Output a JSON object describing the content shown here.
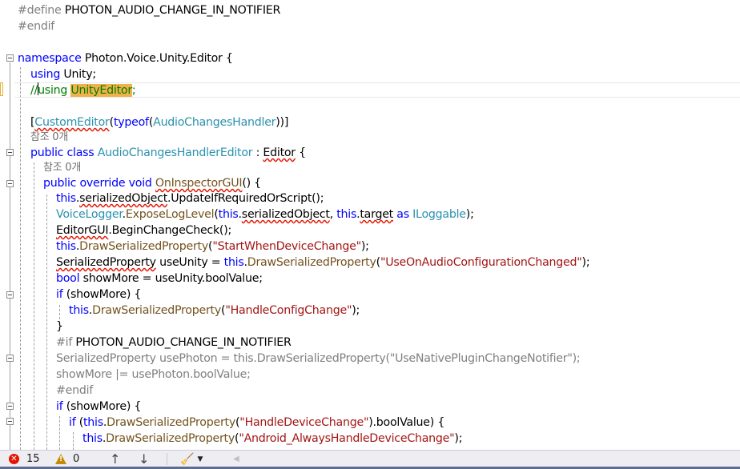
{
  "editor": {
    "lines": {
      "l1": {
        "a": "#define ",
        "b": "PHOTON_AUDIO_CHANGE_IN_NOTIFIER"
      },
      "l2": {
        "a": "#endif"
      },
      "l4": {
        "a": "namespace",
        "b": " Photon.Voice.Unity.Editor {"
      },
      "l5": {
        "a": "using",
        "b": " Unity;"
      },
      "l6": {
        "a": "//",
        "b": "using ",
        "c": "UnityEditor",
        "d": ";"
      },
      "l8": {
        "a": "[",
        "b": "CustomEditor",
        "c": "(",
        "d": "typeof",
        "e": "(",
        "f": "AudioChangesHandler",
        "g": "))]"
      },
      "l9": {
        "a": "참조 0개"
      },
      "l10": {
        "a": "public",
        "b": " ",
        "c": "class",
        "d": " ",
        "e": "AudioChangesHandlerEditor",
        "f": " : ",
        "g": "Editor",
        "h": " {"
      },
      "l11": {
        "a": "참조 0개"
      },
      "l12": {
        "a": "public",
        "b": " ",
        "c": "override",
        "d": " ",
        "e": "void",
        "f": " ",
        "g": "OnInspectorGUI",
        "h": "() {"
      },
      "l13": {
        "a": "this",
        "b": ".",
        "c": "serializedObject",
        "d": ".UpdateIfRequiredOrScript();"
      },
      "l14": {
        "a": "VoiceLogger",
        "b": ".",
        "c": "ExposeLogLevel",
        "d": "(",
        "e": "this",
        "f": ".",
        "g": "serializedObject",
        "h": ", ",
        "i": "this",
        "j": ".",
        "k": "target",
        "l": " ",
        "m": "as",
        "n": " ",
        "o": "ILoggable",
        "p": ");"
      },
      "l15": {
        "a": "EditorGUI",
        "b": ".BeginChangeCheck();"
      },
      "l16": {
        "a": "this",
        "b": ".",
        "c": "DrawSerializedProperty",
        "d": "(",
        "e": "\"StartWhenDeviceChange\"",
        "f": ");"
      },
      "l17": {
        "a": "SerializedProperty",
        "b": " useUnity = ",
        "c": "this",
        "d": ".",
        "e": "DrawSerializedProperty",
        "f": "(",
        "g": "\"UseOnAudioConfigurationChanged\"",
        "h": ");"
      },
      "l18": {
        "a": "bool",
        "b": " showMore = useUnity.boolValue;"
      },
      "l19": {
        "a": "if",
        "b": " (showMore) {"
      },
      "l20": {
        "a": "this",
        "b": ".",
        "c": "DrawSerializedProperty",
        "d": "(",
        "e": "\"HandleConfigChange\"",
        "f": ");"
      },
      "l21": {
        "a": "}"
      },
      "l22": {
        "a": "#if ",
        "b": "PHOTON_AUDIO_CHANGE_IN_NOTIFIER"
      },
      "l23": {
        "a": "SerializedProperty usePhoton = this.DrawSerializedProperty(\"UseNativePluginChangeNotifier\");"
      },
      "l24": {
        "a": "showMore |= usePhoton.boolValue;"
      },
      "l25": {
        "a": "#endif"
      },
      "l26": {
        "a": "if",
        "b": " (showMore) {"
      },
      "l27": {
        "a": "if",
        "b": " (",
        "c": "this",
        "d": ".",
        "e": "DrawSerializedProperty",
        "f": "(",
        "g": "\"HandleDeviceChange\"",
        "h": ").boolValue) {"
      },
      "l28": {
        "a": "this",
        "b": ".",
        "c": "DrawSerializedProperty",
        "d": "(",
        "e": "\"Android_AlwaysHandleDeviceChange\"",
        "f": ");"
      }
    }
  },
  "statusbar": {
    "errors": "15",
    "warnings": "0",
    "up_arrow": "↑",
    "down_arrow": "↓",
    "dropdown": "▼",
    "scroll_left": "◀"
  }
}
